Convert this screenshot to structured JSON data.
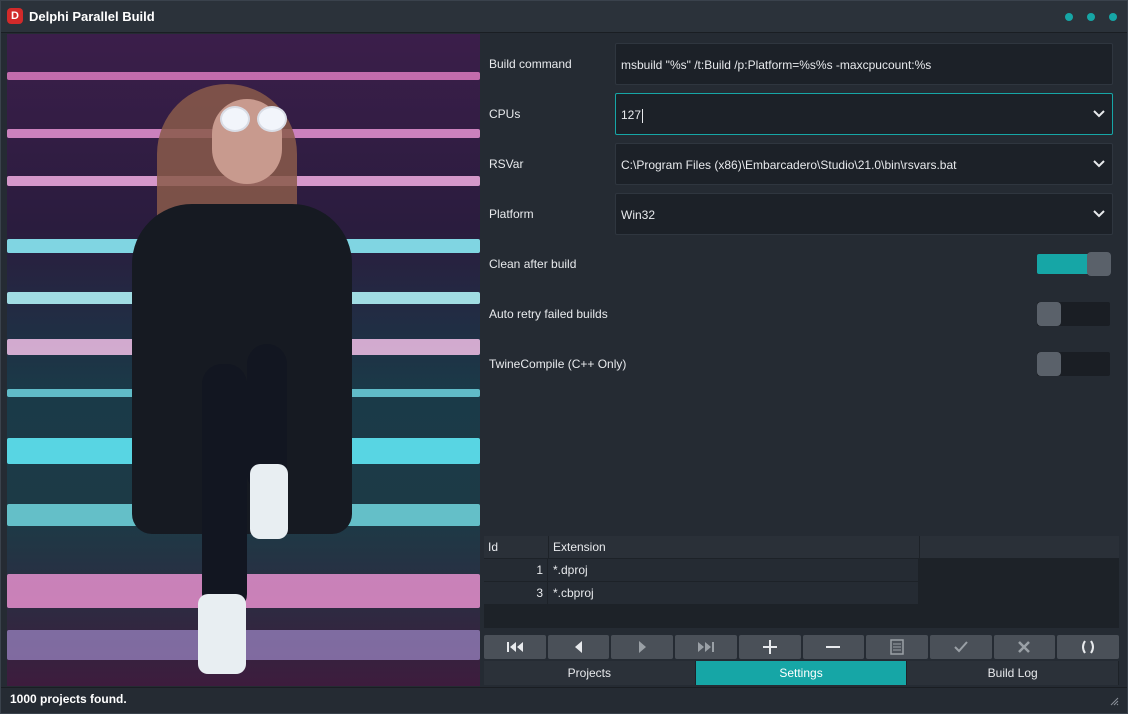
{
  "window": {
    "title": "Delphi Parallel Build",
    "icon_letter": "D",
    "accent_color": "#16a6a6"
  },
  "settings": {
    "build_command": {
      "label": "Build command",
      "value": "msbuild \"%s\" /t:Build /p:Platform=%s%s -maxcpucount:%s"
    },
    "cpus": {
      "label": "CPUs",
      "value": "127"
    },
    "rsvar": {
      "label": "RSVar",
      "value": "C:\\Program Files (x86)\\Embarcadero\\Studio\\21.0\\bin\\rsvars.bat"
    },
    "platform": {
      "label": "Platform",
      "value": "Win32"
    },
    "clean_after_build": {
      "label": "Clean after build",
      "on": true
    },
    "auto_retry": {
      "label": "Auto retry failed builds",
      "on": false
    },
    "twine_compile": {
      "label": "TwineCompile (C++ Only)",
      "on": false
    }
  },
  "extensions_grid": {
    "columns": [
      "Id",
      "Extension"
    ],
    "rows": [
      {
        "id": "1",
        "extension": "*.dproj"
      },
      {
        "id": "3",
        "extension": "*.cbproj"
      }
    ]
  },
  "navigator": {
    "buttons": [
      "first-icon",
      "prior-icon",
      "next-icon",
      "last-icon",
      "insert-icon",
      "delete-icon",
      "edit-icon",
      "post-icon",
      "cancel-icon",
      "refresh-icon"
    ]
  },
  "tabs": [
    {
      "label": "Projects",
      "active": false
    },
    {
      "label": "Settings",
      "active": true
    },
    {
      "label": "Build Log",
      "active": false
    }
  ],
  "status": {
    "text": "1000 projects found."
  }
}
